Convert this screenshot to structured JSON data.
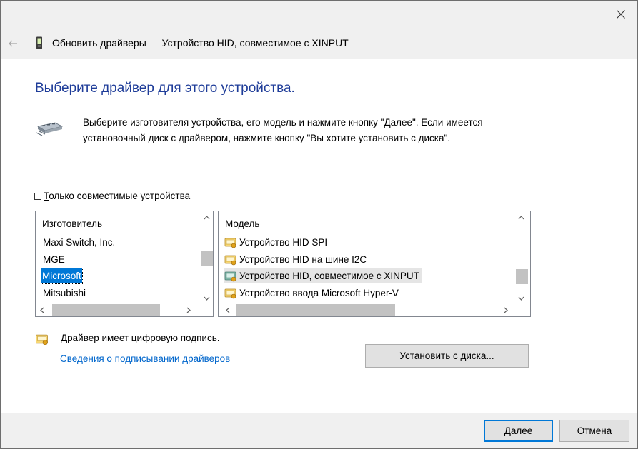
{
  "window": {
    "title": "Обновить драйверы — Устройство HID, совместимое с XINPUT",
    "back_icon": "arrow-left-icon",
    "close_icon": "close-icon"
  },
  "heading": "Выберите драйвер для этого устройства.",
  "description": {
    "line1": "Выберите изготовителя устройства, его модель и нажмите кнопку \"Далее\". Если имеется",
    "line2": "установочный диск с  драйвером, нажмите кнопку \"Вы хотите установить с диска\".",
    "icon": "hardware-install-icon"
  },
  "compatible_checkbox": {
    "label_underlined": "Т",
    "label_rest": "олько совместимые устройства",
    "checked": false
  },
  "manufacturer_list": {
    "header": "Изготовитель",
    "items": [
      "Maxi Switch, Inc.",
      "MGE",
      "Microsoft",
      "Mitsubishi"
    ],
    "selected": "Microsoft"
  },
  "model_list": {
    "header": "Модель",
    "items": [
      "Устройство HID SPI",
      "Устройство HID на шине I2C",
      "Устройство HID, совместимое с XINPUT",
      "Устройство ввода Microsoft Hyper-V"
    ],
    "selected": "Устройство HID, совместимое с XINPUT",
    "item_icon": "signed-driver-icon"
  },
  "signature": {
    "text": "Драйвер имеет цифровую подпись.",
    "link": "Сведения о подписывании драйверов",
    "icon": "signed-driver-icon"
  },
  "buttons": {
    "have_disk_underlined": "У",
    "have_disk_rest": "становить с диска...",
    "next": "Далее",
    "cancel": "Отмена"
  },
  "colors": {
    "heading": "#1f3d99",
    "selection": "#0078d7",
    "link": "#0066cc"
  }
}
